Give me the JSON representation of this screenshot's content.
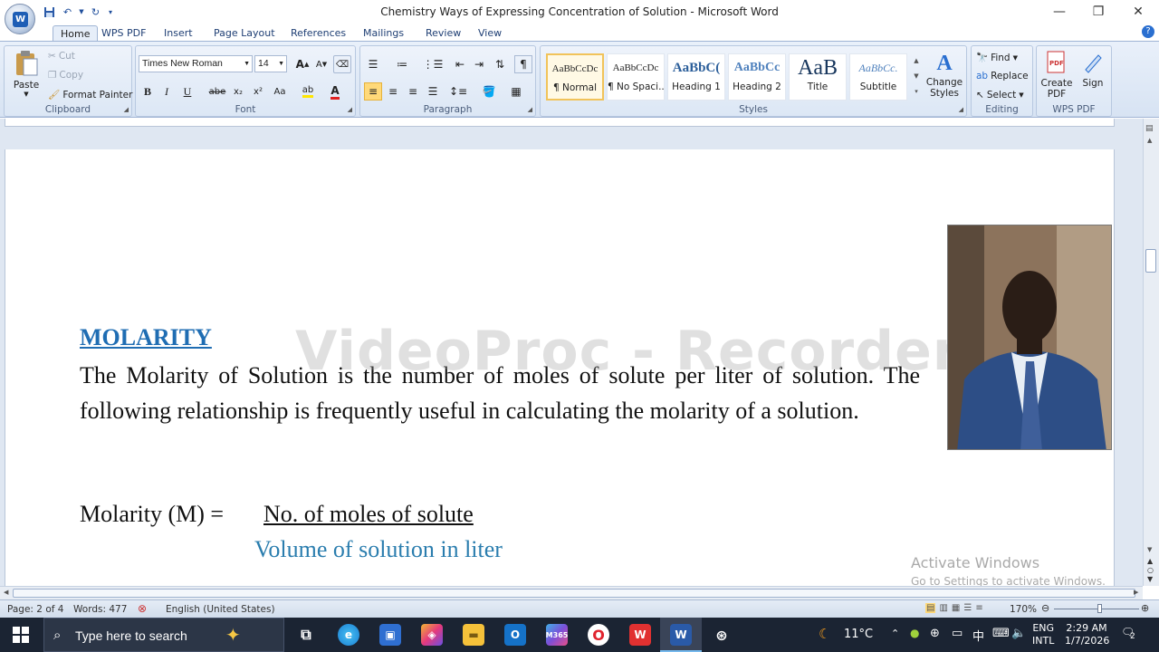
{
  "window": {
    "title": "Chemistry Ways of Expressing Concentration of Solution - Microsoft Word",
    "minimize": "—",
    "restore": "❐",
    "close": "✕"
  },
  "tabs": [
    "Home",
    "WPS PDF",
    "Insert",
    "Page Layout",
    "References",
    "Mailings",
    "Review",
    "View"
  ],
  "active_tab": "Home",
  "clipboard": {
    "paste": "Paste",
    "cut": "Cut",
    "copy": "Copy",
    "format_painter": "Format Painter",
    "label": "Clipboard"
  },
  "font": {
    "name": "Times New Roman",
    "size": "14",
    "label": "Font"
  },
  "paragraph": {
    "label": "Paragraph"
  },
  "styles": {
    "items": [
      {
        "preview": "AaBbCcDc",
        "name": "¶ Normal"
      },
      {
        "preview": "AaBbCcDc",
        "name": "¶ No Spaci..."
      },
      {
        "preview": "AaBbC(",
        "name": "Heading 1"
      },
      {
        "preview": "AaBbCc",
        "name": "Heading 2"
      },
      {
        "preview": "AaB",
        "name": "Title"
      },
      {
        "preview": "AaBbCc.",
        "name": "Subtitle"
      }
    ],
    "change_styles": "Change Styles",
    "label": "Styles"
  },
  "editing": {
    "find": "Find",
    "replace": "Replace",
    "select": "Select",
    "label": "Editing"
  },
  "wps_pdf": {
    "create_pdf": "Create PDF",
    "sign": "Sign",
    "label": "WPS PDF"
  },
  "document": {
    "heading": "MOLARITY",
    "paragraph": "The Molarity of Solution is the number of moles of solute per liter of solution. The following relationship is frequently useful in calculating the molarity of a solution.",
    "formula_lhs": "Molarity (M) = ",
    "formula_numerator": "No. of moles of solute",
    "formula_denominator": "Volume of solution in liter"
  },
  "watermark": "VideoProc - Recorder",
  "activate_windows": {
    "title": "Activate Windows",
    "subtitle": "Go to Settings to activate Windows."
  },
  "status": {
    "page": "Page: 2 of 4",
    "words": "Words: 477",
    "language": "English (United States)",
    "zoom": "170%"
  },
  "taskbar": {
    "search_placeholder": "Type here to search",
    "weather": "11°C",
    "lang_top": "ENG",
    "lang_bottom": "INTL",
    "time": "2:29 AM",
    "date": "1/7/2026",
    "notifications": "2"
  }
}
